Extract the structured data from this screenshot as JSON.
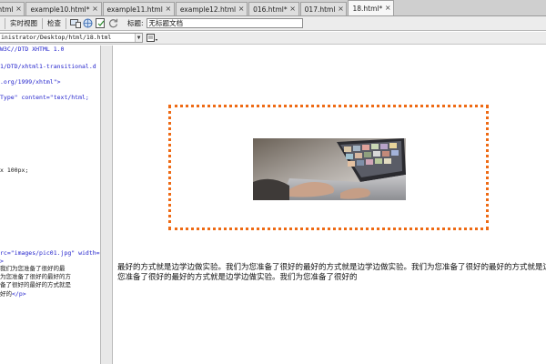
{
  "tabs": [
    {
      "label": ".html",
      "active": false
    },
    {
      "label": "example10.html*",
      "active": false
    },
    {
      "label": "example11.html",
      "active": false
    },
    {
      "label": "example12.html",
      "active": false
    },
    {
      "label": "016.html*",
      "active": false
    },
    {
      "label": "017.html",
      "active": false
    },
    {
      "label": "18.html*",
      "active": true
    }
  ],
  "tab_close_glyph": "×",
  "toolbar": {
    "live_view_label": "实时视图",
    "inspect_label": "检查",
    "title_label": "标题:",
    "title_value": "无标题文档"
  },
  "address": {
    "path": "inistrator/Desktop/html/18.html"
  },
  "code_lines": [
    {
      "blue": "W3C//DTD XHTML 1.0",
      "dark": ""
    },
    {
      "blue": "1/DTD/xhtml1-transitional.d",
      "dark": ""
    },
    {
      "blue": ".org/1999/xhtml\">",
      "dark": ""
    },
    {
      "blue": "Type\" content=\"text/html;",
      "dark": ""
    },
    {
      "blue": "",
      "dark": "x 100px;"
    },
    {
      "blue": "rc=\"images/pic01.jpg\" width=",
      "dark": ""
    },
    {
      "blue": ">",
      "dark": ""
    },
    {
      "blue": "",
      "dark": "我们为您准备了很好的最"
    },
    {
      "blue": "",
      "dark": "为您准备了很好的最好的方"
    },
    {
      "blue": "",
      "dark": "备了很好的最好的方式就是"
    },
    {
      "blue": "</p>",
      "dark": "好的"
    }
  ],
  "design": {
    "paragraph": "最好的方式就是边学边做实验。我们为您准备了很好的最好的方式就是边学边做实验。我们为您准备了很好的最好的方式就是边学边做实验。我们为您准备了很好的最好的方式就是边学边做实验。我们为您准备了很好的"
  },
  "colors": {
    "image_border": "#ee6a14",
    "code_blue": "#2222cc"
  }
}
